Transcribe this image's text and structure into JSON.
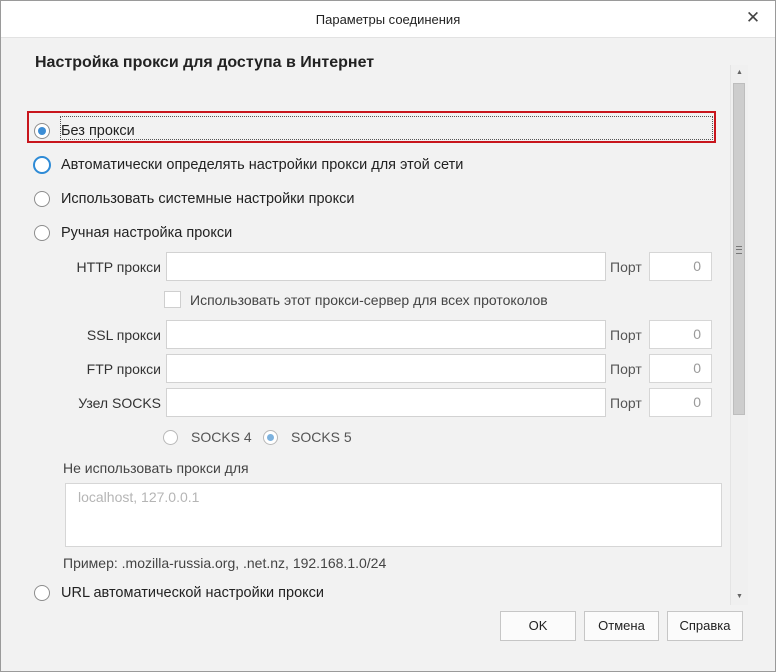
{
  "window": {
    "title": "Параметры соединения",
    "close_glyph": "✕"
  },
  "section": {
    "heading": "Настройка прокси для доступа в Интернет"
  },
  "options": {
    "no_proxy": "Без прокси",
    "auto_detect": "Автоматически определять настройки прокси для этой сети",
    "system": "Использовать системные настройки прокси",
    "manual": "Ручная настройка прокси",
    "auto_url": "URL автоматической настройки прокси"
  },
  "selected_option": "no_proxy",
  "manual": {
    "http_label": "HTTP прокси",
    "http_value": "",
    "http_port": "0",
    "use_for_all_label": "Использовать этот прокси-сервер для всех протоколов",
    "use_for_all_checked": false,
    "ssl_label": "SSL прокси",
    "ssl_value": "",
    "ssl_port": "0",
    "ftp_label": "FTP прокси",
    "ftp_value": "",
    "ftp_port": "0",
    "socks_label": "Узел SOCKS",
    "socks_value": "",
    "socks_port": "0",
    "port_label": "Порт",
    "socks4_label": "SOCKS 4",
    "socks5_label": "SOCKS 5",
    "socks_version_selected": "socks5"
  },
  "no_proxy_for": {
    "label": "Не использовать прокси для",
    "value": "localhost, 127.0.0.1",
    "example": "Пример: .mozilla-russia.org, .net.nz, 192.168.1.0/24"
  },
  "buttons": {
    "ok": "OK",
    "cancel": "Отмена",
    "help": "Справка"
  },
  "colors": {
    "highlight": "#c8161d",
    "radio_accent": "#3c8dd5"
  },
  "icons": {
    "close": "close-icon",
    "scroll_up": "arrow-up-icon",
    "scroll_down": "arrow-down-icon"
  }
}
